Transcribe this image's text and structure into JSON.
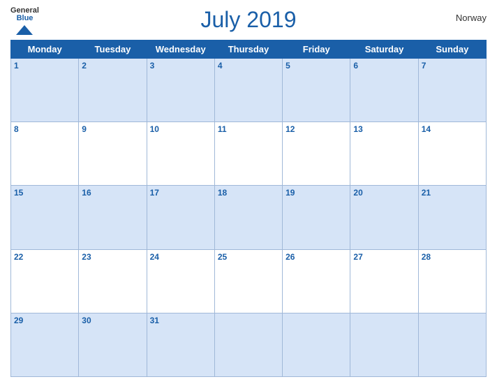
{
  "header": {
    "logo": {
      "general": "General",
      "blue": "Blue",
      "icon": "▲"
    },
    "title": "July 2019",
    "country": "Norway"
  },
  "weekdays": [
    "Monday",
    "Tuesday",
    "Wednesday",
    "Thursday",
    "Friday",
    "Saturday",
    "Sunday"
  ],
  "weeks": [
    [
      {
        "day": 1,
        "empty": false
      },
      {
        "day": 2,
        "empty": false
      },
      {
        "day": 3,
        "empty": false
      },
      {
        "day": 4,
        "empty": false
      },
      {
        "day": 5,
        "empty": false
      },
      {
        "day": 6,
        "empty": false
      },
      {
        "day": 7,
        "empty": false
      }
    ],
    [
      {
        "day": 8,
        "empty": false
      },
      {
        "day": 9,
        "empty": false
      },
      {
        "day": 10,
        "empty": false
      },
      {
        "day": 11,
        "empty": false
      },
      {
        "day": 12,
        "empty": false
      },
      {
        "day": 13,
        "empty": false
      },
      {
        "day": 14,
        "empty": false
      }
    ],
    [
      {
        "day": 15,
        "empty": false
      },
      {
        "day": 16,
        "empty": false
      },
      {
        "day": 17,
        "empty": false
      },
      {
        "day": 18,
        "empty": false
      },
      {
        "day": 19,
        "empty": false
      },
      {
        "day": 20,
        "empty": false
      },
      {
        "day": 21,
        "empty": false
      }
    ],
    [
      {
        "day": 22,
        "empty": false
      },
      {
        "day": 23,
        "empty": false
      },
      {
        "day": 24,
        "empty": false
      },
      {
        "day": 25,
        "empty": false
      },
      {
        "day": 26,
        "empty": false
      },
      {
        "day": 27,
        "empty": false
      },
      {
        "day": 28,
        "empty": false
      }
    ],
    [
      {
        "day": 29,
        "empty": false
      },
      {
        "day": 30,
        "empty": false
      },
      {
        "day": 31,
        "empty": false
      },
      {
        "day": null,
        "empty": true
      },
      {
        "day": null,
        "empty": true
      },
      {
        "day": null,
        "empty": true
      },
      {
        "day": null,
        "empty": true
      }
    ]
  ]
}
